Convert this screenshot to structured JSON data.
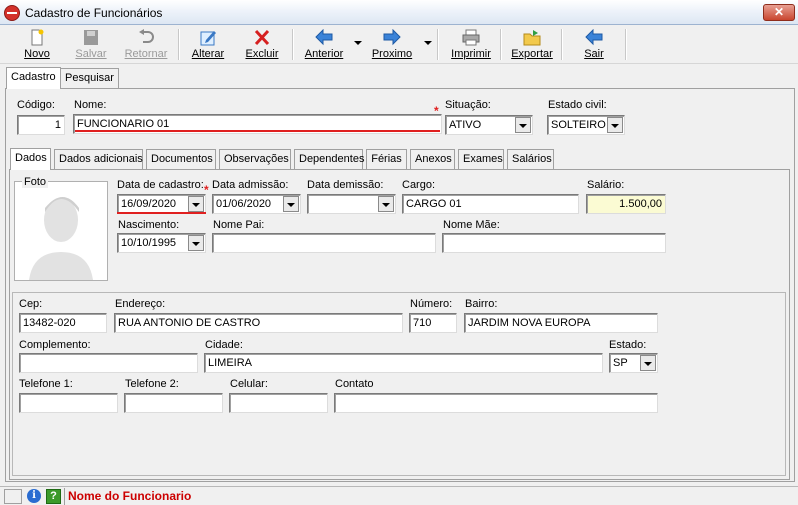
{
  "window": {
    "title": "Cadastro de Funcionários",
    "close_label": "✕"
  },
  "toolbar": {
    "novo": "Novo",
    "salvar": "Salvar",
    "retornar": "Retornar",
    "alterar": "Alterar",
    "excluir": "Excluir",
    "anterior": "Anterior",
    "proximo": "Proximo",
    "imprimir": "Imprimir",
    "exportar": "Exportar",
    "sair": "Sair"
  },
  "main_tabs": {
    "cadastro": "Cadastro",
    "pesquisar": "Pesquisar"
  },
  "header_form": {
    "codigo_label": "Código:",
    "codigo_value": "1",
    "nome_label": "Nome:",
    "nome_value": "FUNCIONARIO 01",
    "situacao_label": "Situação:",
    "situacao_value": "ATIVO",
    "estado_civil_label": "Estado civil:",
    "estado_civil_value": "SOLTEIRO"
  },
  "sub_tabs": [
    "Dados",
    "Dados adicionais",
    "Documentos",
    "Observações",
    "Dependentes",
    "Férias",
    "Anexos",
    "Exames",
    "Salários"
  ],
  "dados": {
    "foto_label": "Foto",
    "data_cadastro_label": "Data de cadastro:",
    "data_cadastro_value": "16/09/2020",
    "data_admissao_label": "Data admissão:",
    "data_admissao_value": "01/06/2020",
    "data_demissao_label": "Data demissão:",
    "data_demissao_value": "",
    "cargo_label": "Cargo:",
    "cargo_value": "CARGO 01",
    "salario_label": "Salário:",
    "salario_value": "1.500,00",
    "nascimento_label": "Nascimento:",
    "nascimento_value": "10/10/1995",
    "nome_pai_label": "Nome Pai:",
    "nome_pai_value": "",
    "nome_mae_label": "Nome Mãe:",
    "nome_mae_value": ""
  },
  "endereco": {
    "cep_label": "Cep:",
    "cep_value": "13482-020",
    "endereco_label": "Endereço:",
    "endereco_value": "RUA ANTONIO DE CASTRO",
    "numero_label": "Número:",
    "numero_value": "710",
    "bairro_label": "Bairro:",
    "bairro_value": "JARDIM NOVA EUROPA",
    "complemento_label": "Complemento:",
    "complemento_value": "",
    "cidade_label": "Cidade:",
    "cidade_value": "LIMEIRA",
    "estado_label": "Estado:",
    "estado_value": "SP",
    "telefone1_label": "Telefone 1:",
    "telefone1_value": "",
    "telefone2_label": "Telefone 2:",
    "telefone2_value": "",
    "celular_label": "Celular:",
    "celular_value": "",
    "contato_label": "Contato",
    "contato_value": ""
  },
  "status": {
    "hint": "Nome do Funcionario",
    "info_icon": "i",
    "help_icon": "?"
  },
  "colors": {
    "required": "#e02020",
    "salary_bg": "#fbfbd3",
    "status_text": "#cc0000"
  }
}
